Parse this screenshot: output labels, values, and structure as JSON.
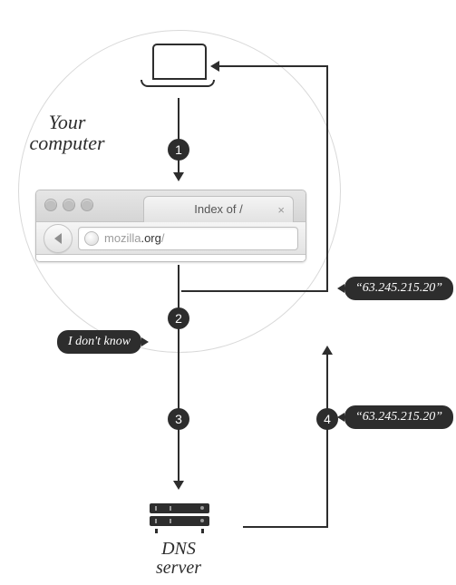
{
  "labels": {
    "your_computer_line1": "Your",
    "your_computer_line2": "computer",
    "dns_server_line1": "DNS",
    "dns_server_line2": "server"
  },
  "steps": {
    "s1": "1",
    "s2": "2",
    "s3": "3",
    "s4": "4"
  },
  "bubbles": {
    "i_dont_know": "I don't know",
    "ip_return": "“63.245.215.20”",
    "ip_from_dns": "“63.245.215.20”"
  },
  "browser": {
    "tab_title": "Index of /",
    "url_grey_prefix": "mozilla",
    "url_dark": ".org",
    "url_grey_suffix": "/"
  }
}
